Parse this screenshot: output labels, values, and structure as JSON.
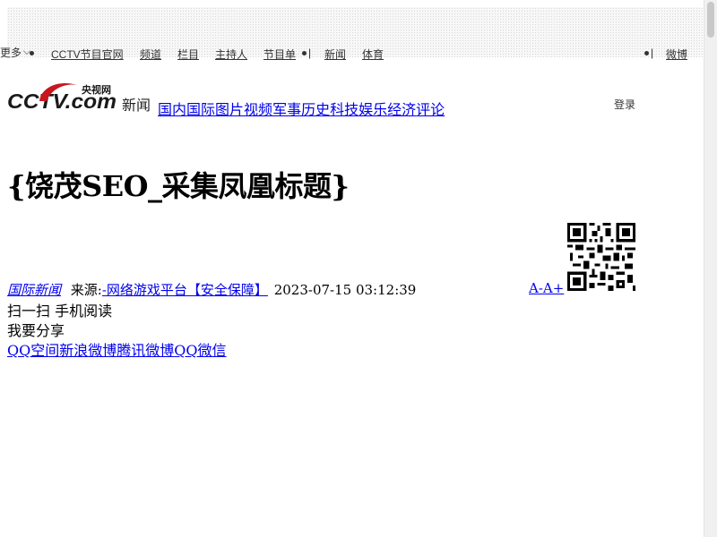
{
  "top_nav": {
    "items": [
      "CCTV节目官网",
      "频道",
      "栏目",
      "主持人",
      "节目单",
      "新闻",
      "体育",
      "更多"
    ],
    "right_item": "微博",
    "separator": "|"
  },
  "logo": {
    "brand_text": "CCTV.com",
    "brand_cn": "央视网",
    "section_label": "新闻"
  },
  "main_nav": {
    "items": [
      "国内",
      "国际",
      "图片",
      "视频",
      "军事",
      "历史",
      "科技",
      "娱乐",
      "经济",
      "评论"
    ]
  },
  "login_label": "登录",
  "article": {
    "title": "{饶茂SEO_采集凤凰标题}",
    "category": "国际新闻",
    "source_prefix": "来源:",
    "source": "-网络游戏平台【安全保障】",
    "datetime": "2023-07-15 03:12:39",
    "font_smaller": "A-",
    "font_larger": "A+",
    "scan_text": "扫一扫 手机阅读",
    "share_label": "我要分享",
    "share_targets": [
      "QQ空间",
      "新浪微博",
      "腾讯微博",
      "QQ",
      "微信"
    ]
  }
}
